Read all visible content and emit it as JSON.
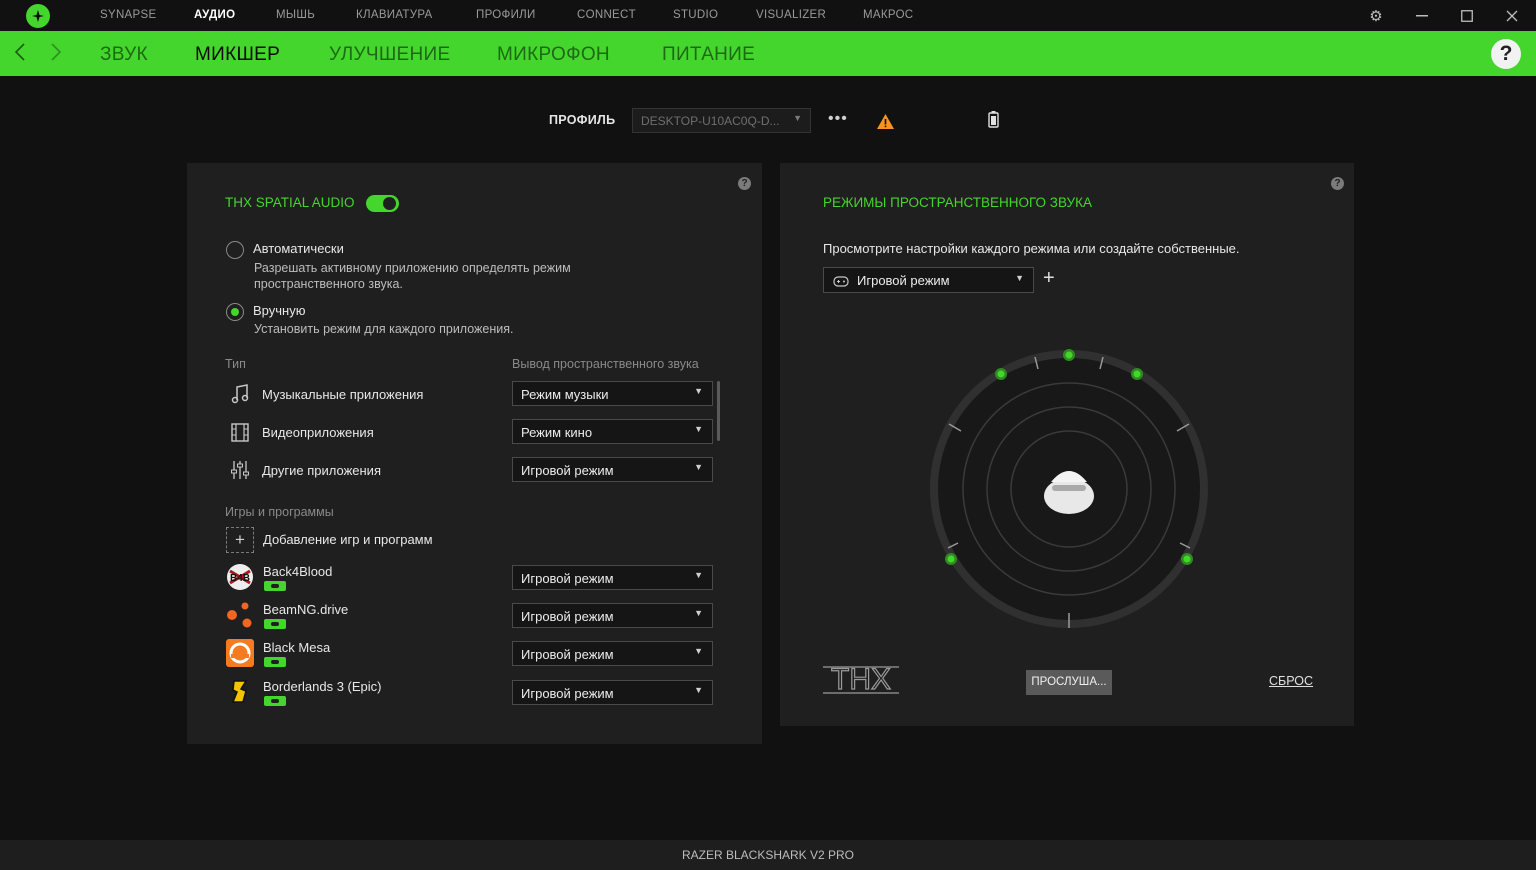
{
  "topnav": {
    "items": [
      "SYNAPSE",
      "АУДИО",
      "МЫШЬ",
      "КЛАВИАТУРА",
      "ПРОФИЛИ",
      "CONNECT",
      "STUDIO",
      "VISUALIZER",
      "МАКРОС"
    ],
    "active": "АУДИО"
  },
  "subnav": {
    "tabs": [
      "ЗВУК",
      "МИКШЕР",
      "УЛУЧШЕНИЕ",
      "МИКРОФОН",
      "ПИТАНИЕ"
    ],
    "active": "МИКШЕР",
    "help": "?"
  },
  "profile": {
    "label": "ПРОФИЛЬ",
    "value": "DESKTOP-U10AC0Q-D...",
    "more": "•••"
  },
  "left_panel": {
    "title": "THX SPATIAL AUDIO",
    "toggle_on": true,
    "auto": {
      "title": "Автоматически",
      "desc": "Разрешать активному приложению определять режим пространственного звука."
    },
    "manual": {
      "title": "Вручную",
      "desc": "Установить режим для каждого приложения."
    },
    "type_header": "Тип",
    "output_header": "Вывод пространственного звука",
    "types": [
      {
        "icon": "music-note-icon",
        "label": "Музыкальные приложения",
        "mode": "Режим музыки"
      },
      {
        "icon": "film-icon",
        "label": "Видеоприложения",
        "mode": "Режим кино"
      },
      {
        "icon": "sliders-icon",
        "label": "Другие приложения",
        "mode": "Игровой режим"
      }
    ],
    "games_header": "Игры и программы",
    "add_label": "Добавление игр и программ",
    "games": [
      {
        "name": "Back4Blood",
        "mode": "Игровой режим"
      },
      {
        "name": "BeamNG.drive",
        "mode": "Игровой режим"
      },
      {
        "name": "Black Mesa",
        "mode": "Игровой режим"
      },
      {
        "name": "Borderlands 3 (Epic)",
        "mode": "Игровой режим"
      }
    ]
  },
  "right_panel": {
    "title": "РЕЖИМЫ ПРОСТРАНСТВЕННОГО ЗВУКА",
    "description": "Просмотрите настройки каждого режима или создайте собственные.",
    "mode": "Игровой режим",
    "listen_button": "ПРОСЛУША...",
    "reset_link": "СБРОС",
    "thx_logo_text": "THX"
  },
  "status": {
    "device": "RAZER BLACKSHARK V2 PRO"
  },
  "colors": {
    "accent": "#44d62c",
    "background": "#111111",
    "panel": "#1f1f1f",
    "warning": "#f7931e"
  }
}
